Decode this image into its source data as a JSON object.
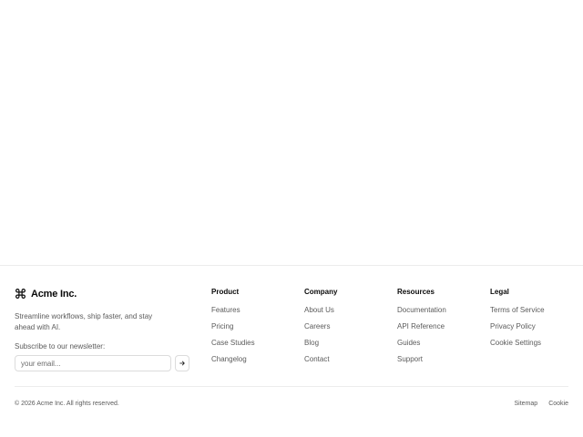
{
  "brand": {
    "name": "Acme Inc.",
    "tagline": "Streamline workflows, ship faster, and stay ahead with AI."
  },
  "newsletter": {
    "label": "Subscribe to our newsletter:",
    "placeholder": "your email...",
    "submit_icon": "arrow-right-icon"
  },
  "columns": [
    {
      "title": "Product",
      "links": [
        "Features",
        "Pricing",
        "Case Studies",
        "Changelog"
      ]
    },
    {
      "title": "Company",
      "links": [
        "About Us",
        "Careers",
        "Blog",
        "Contact"
      ]
    },
    {
      "title": "Resources",
      "links": [
        "Documentation",
        "API Reference",
        "Guides",
        "Support"
      ]
    },
    {
      "title": "Legal",
      "links": [
        "Terms of Service",
        "Privacy Policy",
        "Cookie Settings"
      ]
    }
  ],
  "bottom": {
    "copyright": "© 2026 Acme Inc. All rights reserved.",
    "links": [
      "Sitemap",
      "Cookie"
    ]
  },
  "colors": {
    "text": "#0a0a0a",
    "muted": "#5b5b5b",
    "border": "#ececec"
  }
}
